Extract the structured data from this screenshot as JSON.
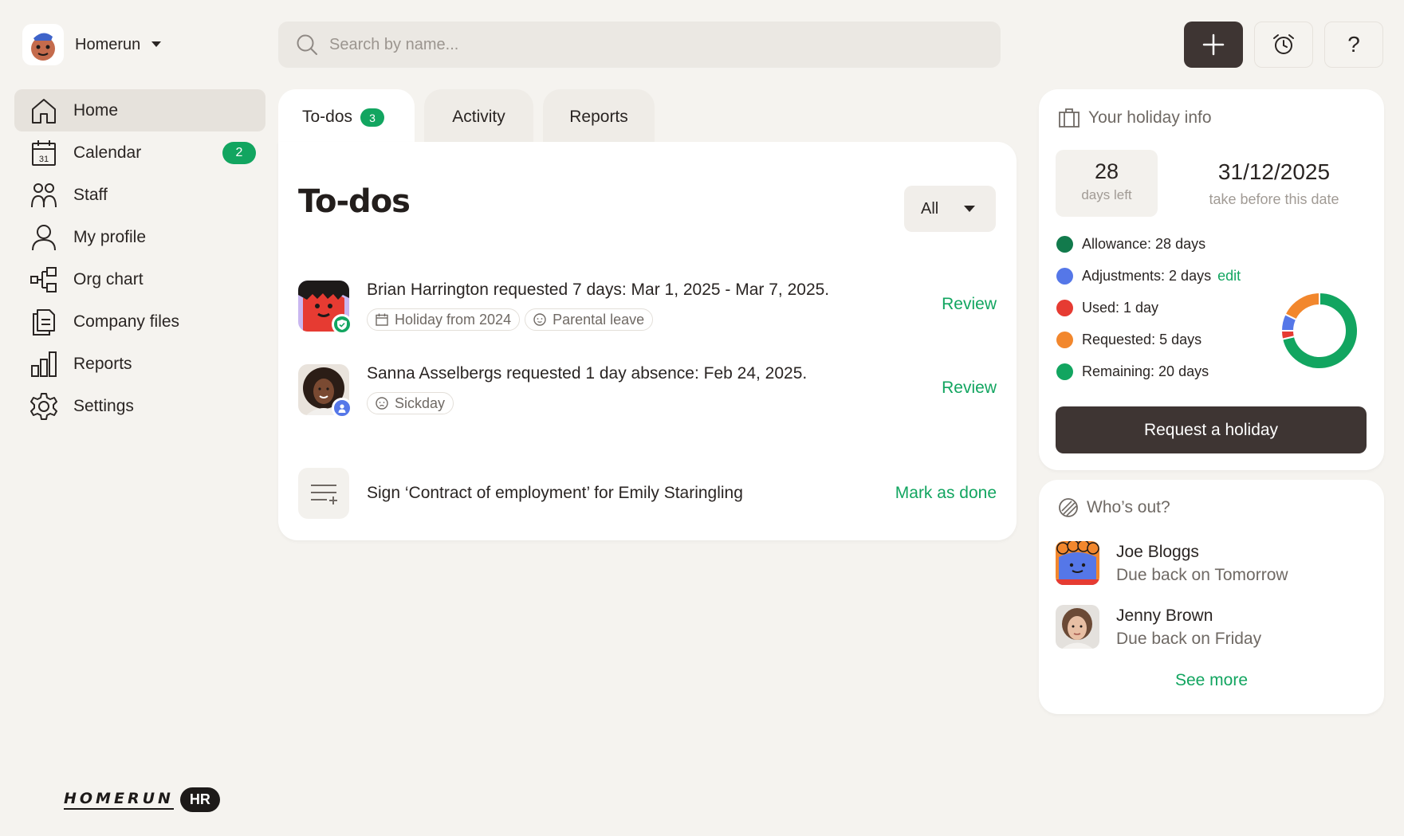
{
  "brand": {
    "name": "Homerun"
  },
  "search": {
    "placeholder": "Search by name..."
  },
  "topbar": {
    "add_icon": "plus-icon",
    "alarm_icon": "alarm-clock-icon",
    "help_label": "?"
  },
  "nav": [
    {
      "label": "Home",
      "icon": "home-icon",
      "active": true
    },
    {
      "label": "Calendar",
      "icon": "calendar-icon",
      "badge": "2",
      "date_num": "31"
    },
    {
      "label": "Staff",
      "icon": "staff-icon"
    },
    {
      "label": "My profile",
      "icon": "user-icon"
    },
    {
      "label": "Org chart",
      "icon": "org-chart-icon"
    },
    {
      "label": "Company files",
      "icon": "files-icon"
    },
    {
      "label": "Reports",
      "icon": "bar-chart-icon"
    },
    {
      "label": "Settings",
      "icon": "gear-icon"
    }
  ],
  "footer": {
    "wordmark": "HOMERUN",
    "badge": "HR"
  },
  "tabs": [
    {
      "label": "To-dos",
      "count": "3",
      "active": true
    },
    {
      "label": "Activity"
    },
    {
      "label": "Reports"
    }
  ],
  "todos_panel": {
    "title": "To-dos",
    "filter_value": "All",
    "items": [
      {
        "text": "Brian Harrington requested 7 days: Mar 1, 2025 - Mar 7, 2025.",
        "chips": [
          "Holiday from 2024",
          "Parental leave"
        ],
        "action": "Review"
      },
      {
        "text": "Sanna Asselbergs requested 1 day absence: Feb 24, 2025.",
        "chips": [
          "Sickday"
        ],
        "action": "Review"
      },
      {
        "text": "Sign ‘Contract of employment’ for Emily Staringling",
        "chips": [],
        "action": "Mark as done"
      }
    ]
  },
  "holiday": {
    "title": "Your holiday info",
    "days_left_value": "28",
    "days_left_label": "days left",
    "deadline_value": "31/12/2025",
    "deadline_label": "take before this date",
    "legend": [
      {
        "label": "Allowance: 28 days",
        "color": "#127a4c"
      },
      {
        "label": "Adjustments: 2 days",
        "color": "#5577e8",
        "link": "edit"
      },
      {
        "label": "Used: 1 day",
        "color": "#e63b32"
      },
      {
        "label": "Requested: 5 days",
        "color": "#f2872d"
      },
      {
        "label": "Remaining: 20 days",
        "color": "#12a560"
      }
    ],
    "donut": [
      {
        "name": "Remaining",
        "value": 20,
        "color": "#12a560"
      },
      {
        "name": "Used",
        "value": 1,
        "color": "#e63b32"
      },
      {
        "name": "Adjustments",
        "value": 2,
        "color": "#5577e8"
      },
      {
        "name": "Requested",
        "value": 5,
        "color": "#f2872d"
      }
    ],
    "button": "Request a holiday"
  },
  "whos_out": {
    "title": "Who’s out?",
    "people": [
      {
        "name": "Joe Bloggs",
        "due": "Due back on Tomorrow"
      },
      {
        "name": "Jenny Brown",
        "due": "Due back on Friday"
      }
    ],
    "see_more": "See more"
  },
  "colors": {
    "accent": "#12a560",
    "dark": "#3e3533",
    "background": "#f5f3ef"
  }
}
